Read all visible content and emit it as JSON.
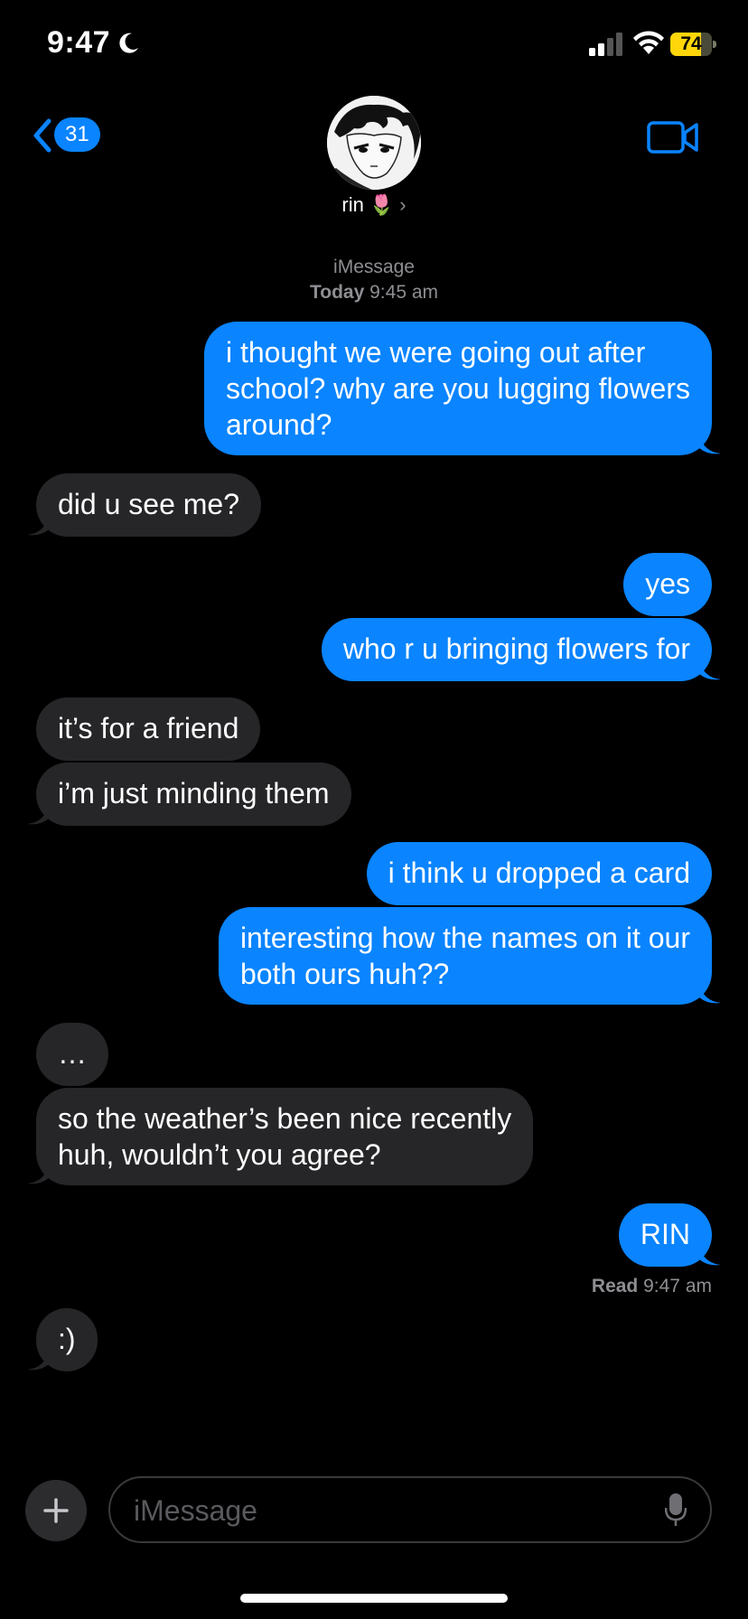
{
  "status_bar": {
    "time": "9:47",
    "battery_level": 74,
    "battery_label": "74",
    "icons": [
      "moon-icon",
      "signal-icon",
      "wifi-icon",
      "battery-icon"
    ]
  },
  "header": {
    "back_count": "31",
    "contact_name": "rin",
    "contact_emoji": "🌷",
    "contact_chevron": "›"
  },
  "thread": {
    "service": "iMessage",
    "date_label": "Today",
    "date_time": "9:45 am",
    "read_label": "Read",
    "read_time": "9:47 am"
  },
  "messages": [
    {
      "from": "me",
      "text": "i thought we were going out after\nschool? why are you lugging flowers\naround?"
    },
    {
      "from": "them",
      "text": "did u see me?"
    },
    {
      "from": "me",
      "text": "yes"
    },
    {
      "from": "me",
      "text": "who r u bringing flowers for"
    },
    {
      "from": "them",
      "text": "it’s for a friend"
    },
    {
      "from": "them",
      "text": "i’m just minding them"
    },
    {
      "from": "me",
      "text": "i think u dropped a card"
    },
    {
      "from": "me",
      "text": "interesting how the names on it our\nboth ours huh??"
    },
    {
      "from": "them",
      "text": "…"
    },
    {
      "from": "them",
      "text": "so the weather’s been nice recently\nhuh, wouldn’t you agree?"
    },
    {
      "from": "me",
      "text": "RIN"
    },
    {
      "from": "them",
      "text": ":)"
    }
  ],
  "composer": {
    "placeholder": "iMessage"
  },
  "colors": {
    "sent_bubble": "#0a84ff",
    "received_bubble": "#262628",
    "background": "#000000",
    "battery": "#ffd60a"
  }
}
